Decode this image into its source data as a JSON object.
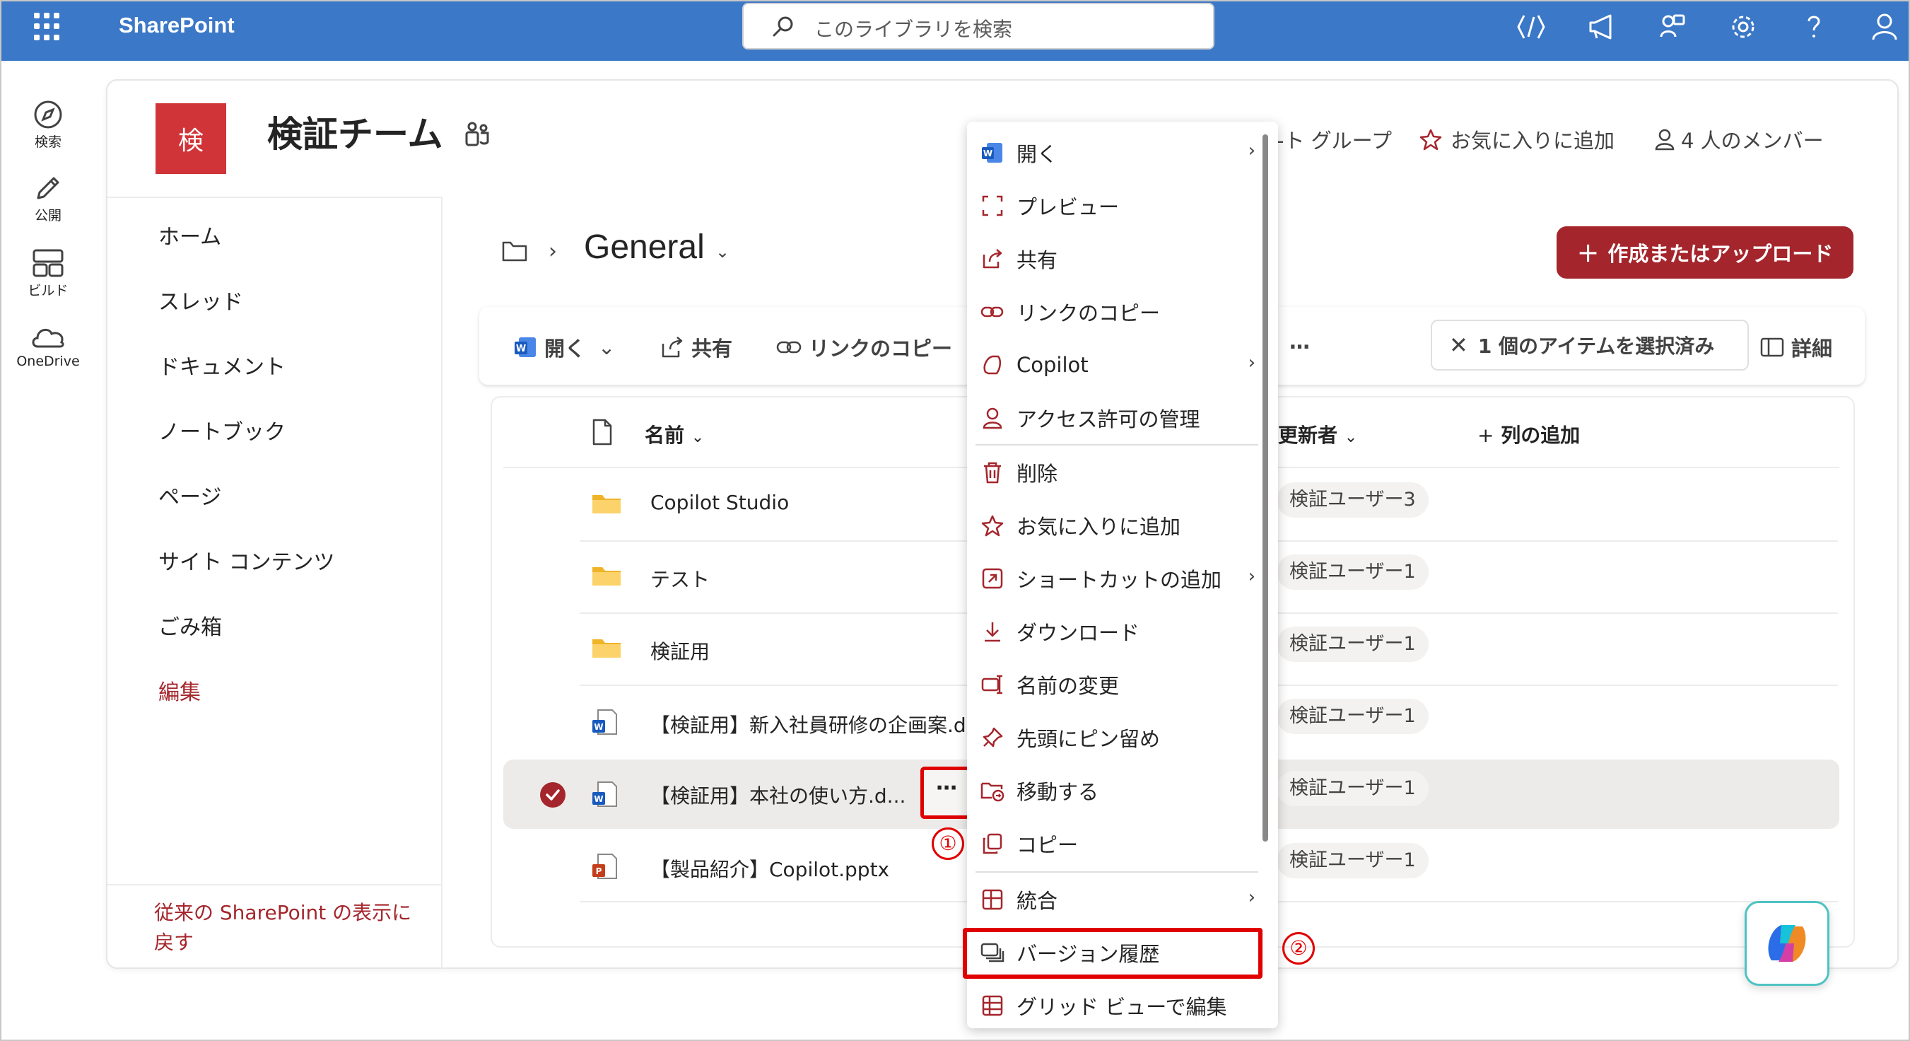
{
  "topbar": {
    "brand": "SharePoint",
    "search_placeholder": "このライブラリを検索",
    "bg_color": "#3b78c7"
  },
  "rail": [
    {
      "label": "検索",
      "icon": "compass-icon"
    },
    {
      "label": "公開",
      "icon": "pen-icon"
    },
    {
      "label": "ビルド",
      "icon": "layout-icon"
    },
    {
      "label": "OneDrive",
      "icon": "cloud-icon"
    }
  ],
  "site": {
    "logo_letter": "検",
    "title": "検証チーム",
    "partial_group": "-ト グループ",
    "favorite": "お気に入りに追加",
    "members": "4 人のメンバー"
  },
  "nav": {
    "items": [
      "ホーム",
      "スレッド",
      "ドキュメント",
      "ノートブック",
      "ページ",
      "サイト コンテンツ",
      "ごみ箱"
    ],
    "edit": "編集",
    "classic_line1": "従来の SharePoint の表示に",
    "classic_line2": "戻す"
  },
  "breadcrumb": {
    "title": "General"
  },
  "create_button": "作成またはアップロード",
  "commandbar": {
    "open": "開く",
    "share": "共有",
    "copy_link": "リンクのコピー",
    "more": "…",
    "selected": "1 個のアイテムを選択済み",
    "details": "詳細"
  },
  "columns": {
    "name": "名前",
    "modified_by": "更新者",
    "add_column": "列の追加"
  },
  "rows": [
    {
      "name": "Copilot Studio",
      "modifier": "検証ユーザー3",
      "type": "folder"
    },
    {
      "name": "テスト",
      "modifier": "検証ユーザー1",
      "type": "folder"
    },
    {
      "name": "検証用",
      "modifier": "検証ユーザー1",
      "type": "folder"
    },
    {
      "name": "【検証用】新入社員研修の企画案.d",
      "modifier": "検証ユーザー1",
      "type": "word"
    },
    {
      "name": "【検証用】本社の使い方.d...",
      "modifier": "検証ユーザー1",
      "type": "word",
      "selected": true
    },
    {
      "name": "【製品紹介】Copilot.pptx",
      "modifier": "検証ユーザー1",
      "type": "ppt"
    }
  ],
  "more_button": "⋯",
  "badges": [
    "①",
    "②"
  ],
  "menu": {
    "open": "開く",
    "preview": "プレビュー",
    "share": "共有",
    "copy_link": "リンクのコピー",
    "copilot": "Copilot",
    "manage_access": "アクセス許可の管理",
    "delete": "削除",
    "favorite": "お気に入りに追加",
    "add_shortcut": "ショートカットの追加",
    "download": "ダウンロード",
    "rename": "名前の変更",
    "pin": "先頭にピン留め",
    "move": "移動する",
    "copy": "コピー",
    "integrate": "統合",
    "version_history": "バージョン履歴",
    "grid_edit": "グリッド ビューで編集"
  },
  "colors": {
    "accent": "#a4262c",
    "highlight": "#e00000",
    "word": "#185abd",
    "ppt": "#c43e1c",
    "folder": "#f0b429"
  }
}
